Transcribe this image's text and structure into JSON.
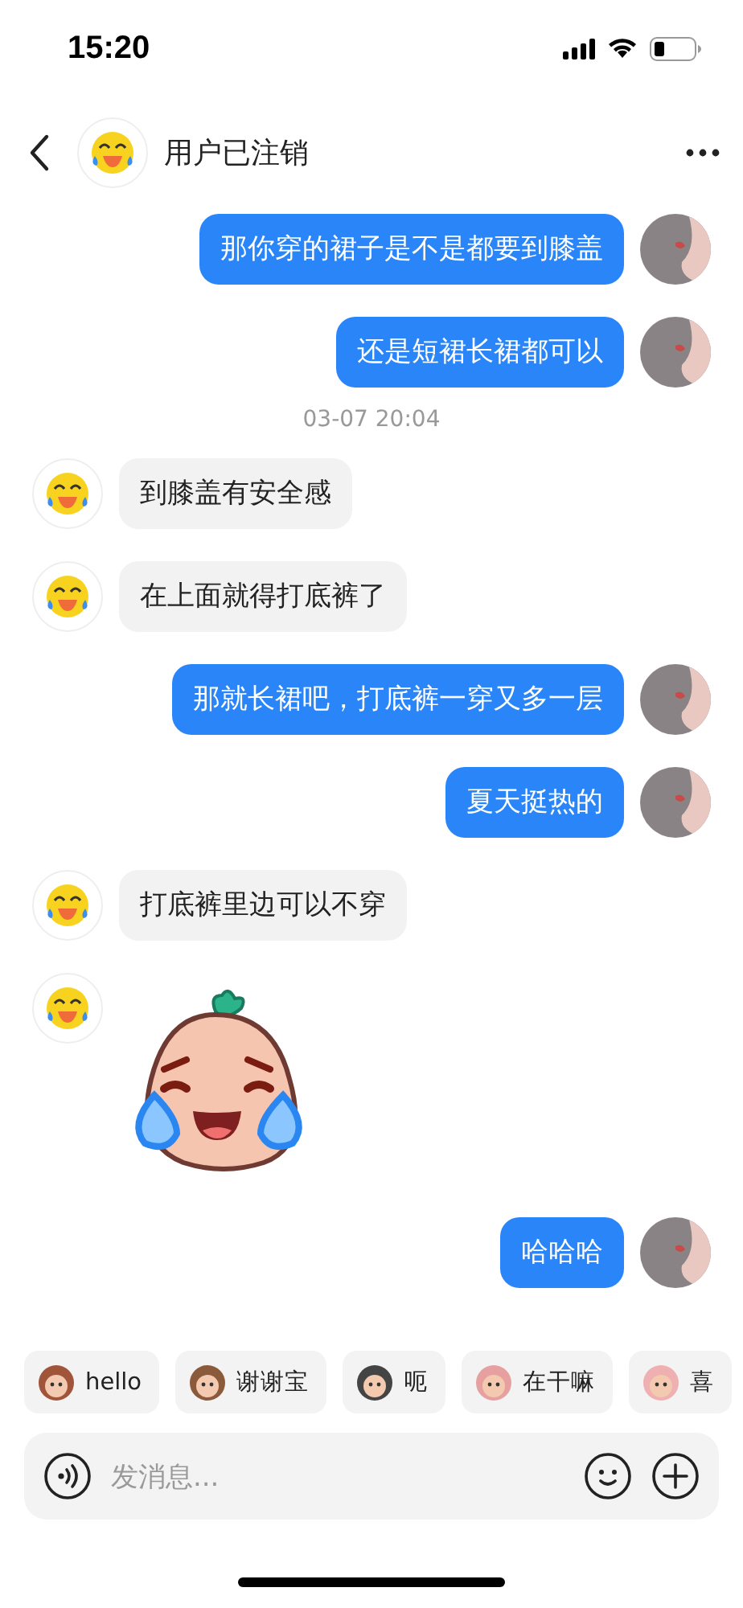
{
  "status_bar": {
    "time": "15:20"
  },
  "header": {
    "title": "用户已注销"
  },
  "messages": [
    {
      "kind": "sent",
      "text": "那你穿的裙子是不是都要到膝盖"
    },
    {
      "kind": "sent",
      "text": "还是短裙长裙都可以"
    },
    {
      "kind": "timestamp",
      "text": "03-07 20:04"
    },
    {
      "kind": "received",
      "text": "到膝盖有安全感"
    },
    {
      "kind": "received",
      "text": "在上面就得打底裤了"
    },
    {
      "kind": "sent",
      "text": "那就长裙吧，打底裤一穿又多一层"
    },
    {
      "kind": "sent",
      "text": "夏天挺热的"
    },
    {
      "kind": "received",
      "text": "打底裤里边可以不穿"
    },
    {
      "kind": "sticker"
    },
    {
      "kind": "sent",
      "text": "哈哈哈"
    }
  ],
  "quick_replies": [
    {
      "label": "hello"
    },
    {
      "label": "谢谢宝"
    },
    {
      "label": "呃"
    },
    {
      "label": "在干嘛"
    },
    {
      "label": "喜"
    }
  ],
  "input": {
    "placeholder": "发消息..."
  }
}
